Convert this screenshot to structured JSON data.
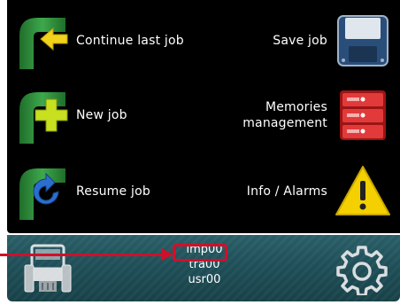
{
  "menu": {
    "continue_last_job": {
      "label": "Continue last job",
      "icon": "pipe-arrow-left-icon"
    },
    "save_job": {
      "label": "Save job",
      "icon": "floppy-disk-icon"
    },
    "new_job": {
      "label": "New job",
      "icon": "pipe-plus-icon"
    },
    "memories_management": {
      "label_line1": "Memories",
      "label_line2": "management",
      "icon": "memory-cabinet-icon"
    },
    "resume_job": {
      "label": "Resume job",
      "icon": "pipe-refresh-icon"
    },
    "info_alarms": {
      "label": "Info / Alarms",
      "icon": "warning-triangle-icon"
    }
  },
  "status_bar": {
    "implement_profile": "imp00",
    "tractor_profile": "tra00",
    "user_profile": "usr00",
    "left_icon": "tractor-icon",
    "right_icon": "gear-icon"
  },
  "colors": {
    "background": "#000000",
    "status_bar": "#1f4f58",
    "callout": "#d0102a",
    "pipe_green": "#2f8a3a",
    "arrow_yellow": "#f2d21a",
    "arrow_blue": "#2a6fd0",
    "memory_red": "#d42a2a",
    "floppy_blue": "#2a4e7a",
    "warning_yellow": "#f5d000"
  }
}
